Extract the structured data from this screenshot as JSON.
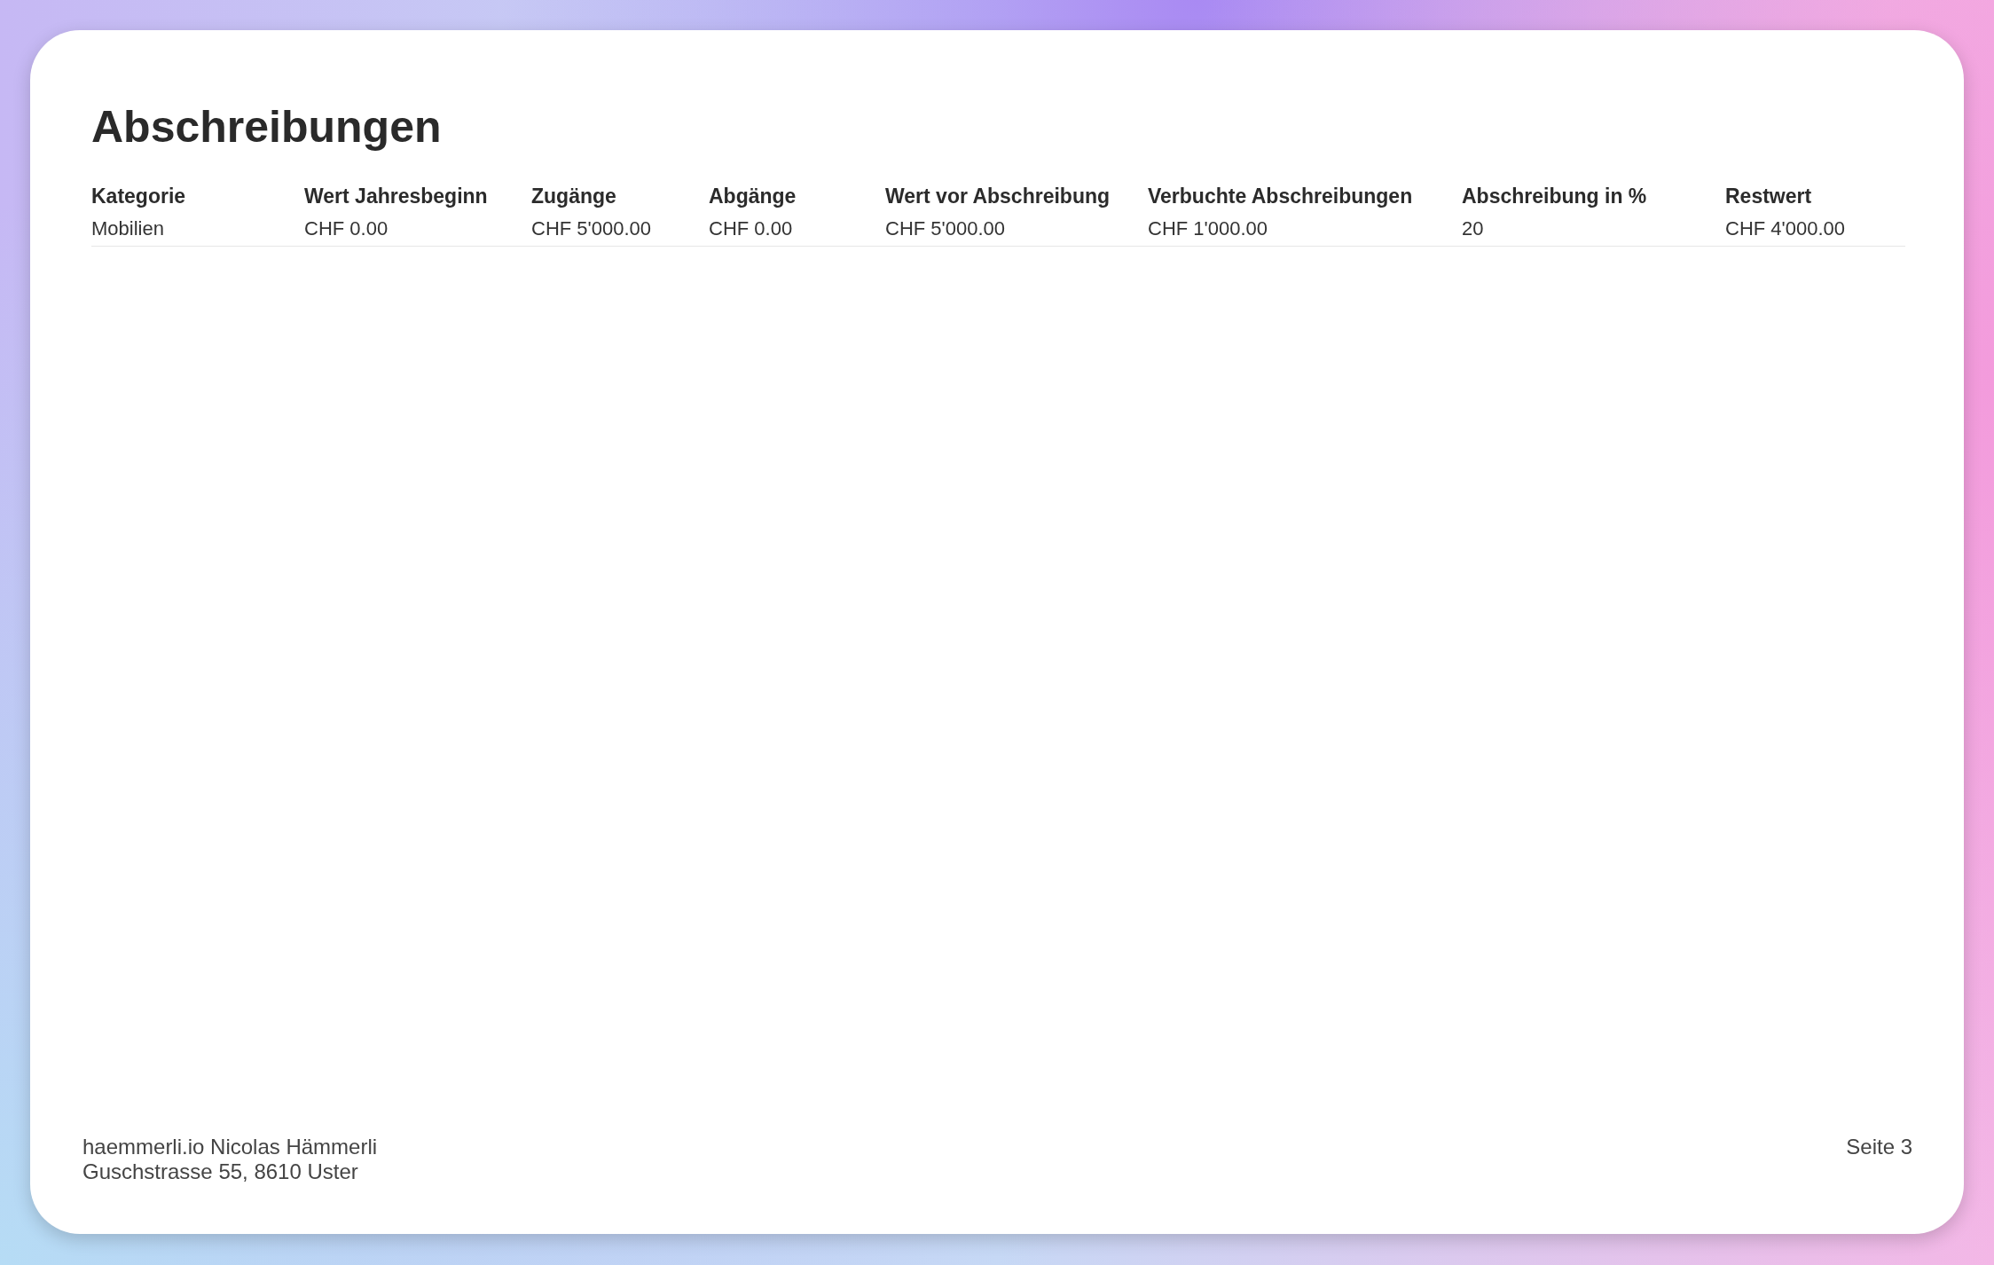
{
  "title": "Abschreibungen",
  "table": {
    "columns": [
      "Kategorie",
      "Wert Jahresbeginn",
      "Zugänge",
      "Abgänge",
      "Wert vor Abschreibung",
      "Verbuchte Abschreibungen",
      "Abschreibung in %",
      "Restwert"
    ],
    "rows": [
      [
        "Mobilien",
        "CHF 0.00",
        "CHF 5'000.00",
        "CHF 0.00",
        "CHF 5'000.00",
        "CHF 1'000.00",
        "20",
        "CHF 4'000.00"
      ]
    ]
  },
  "footer": {
    "address_lines": [
      "haemmerli.io Nicolas Hämmerli",
      "Guschstrasse 55, 8610 Uster"
    ],
    "page": "Seite 3"
  }
}
